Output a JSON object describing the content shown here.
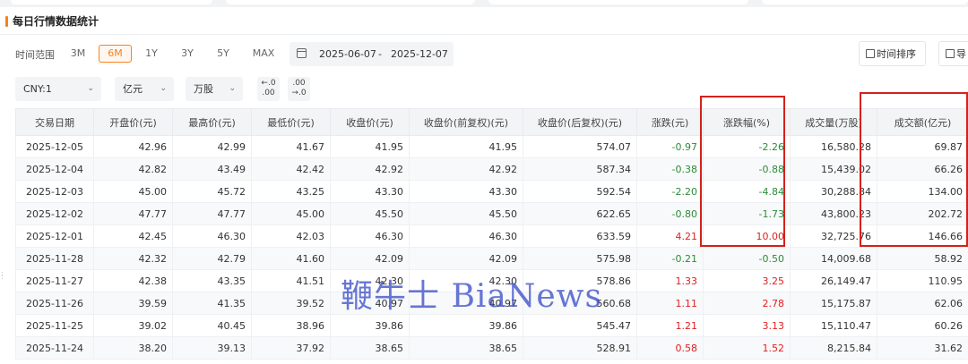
{
  "section": {
    "title": "每日行情数据统计"
  },
  "range": {
    "label": "时间范围",
    "options": [
      "3M",
      "6M",
      "1Y",
      "3Y",
      "5Y",
      "MAX"
    ],
    "active": "6M",
    "start": "2025-06-07",
    "separator": "-",
    "end": "2025-12-07"
  },
  "tools": {
    "sort_label": "时间排序",
    "export_label": "导"
  },
  "selects": {
    "currency": "CNY:1",
    "amount_unit": "亿元",
    "volume_unit": "万股"
  },
  "decimal": {
    "decrease": "←.0\n.00",
    "increase": ".00\n→.0"
  },
  "table": {
    "headers": [
      "交易日期",
      "开盘价(元)",
      "最高价(元)",
      "最低价(元)",
      "收盘价(元)",
      "收盘价(前复权)(元)",
      "收盘价(后复权)(元)",
      "涨跌(元)",
      "涨跌幅(%)",
      "成交量(万股)",
      "成交额(亿元)"
    ],
    "rows": [
      [
        "2025-12-05",
        "42.96",
        "42.99",
        "41.67",
        "41.95",
        "41.95",
        "574.07",
        "-0.97",
        "-2.26",
        "16,580.28",
        "69.87"
      ],
      [
        "2025-12-04",
        "42.82",
        "43.49",
        "42.42",
        "42.92",
        "42.92",
        "587.34",
        "-0.38",
        "-0.88",
        "15,439.02",
        "66.26"
      ],
      [
        "2025-12-03",
        "45.00",
        "45.72",
        "43.25",
        "43.30",
        "43.30",
        "592.54",
        "-2.20",
        "-4.84",
        "30,288.84",
        "134.00"
      ],
      [
        "2025-12-02",
        "47.77",
        "47.77",
        "45.00",
        "45.50",
        "45.50",
        "622.65",
        "-0.80",
        "-1.73",
        "43,800.23",
        "202.72"
      ],
      [
        "2025-12-01",
        "42.45",
        "46.30",
        "42.03",
        "46.30",
        "46.30",
        "633.59",
        "4.21",
        "10.00",
        "32,725.76",
        "146.66"
      ],
      [
        "2025-11-28",
        "42.32",
        "42.79",
        "41.60",
        "42.09",
        "42.09",
        "575.98",
        "-0.21",
        "-0.50",
        "14,009.68",
        "58.92"
      ],
      [
        "2025-11-27",
        "42.38",
        "43.35",
        "41.51",
        "42.30",
        "42.30",
        "578.86",
        "1.33",
        "3.25",
        "26,149.47",
        "110.95"
      ],
      [
        "2025-11-26",
        "39.59",
        "41.35",
        "39.52",
        "40.97",
        "40.97",
        "560.68",
        "1.11",
        "2.78",
        "15,175.87",
        "62.06"
      ],
      [
        "2025-11-25",
        "39.02",
        "40.45",
        "38.96",
        "39.86",
        "39.86",
        "545.47",
        "1.21",
        "3.13",
        "15,110.47",
        "60.26"
      ],
      [
        "2025-11-24",
        "38.20",
        "39.13",
        "37.92",
        "38.65",
        "38.65",
        "528.91",
        "0.58",
        "1.52",
        "8,215.84",
        "31.62"
      ]
    ]
  },
  "watermark": "鞭牛士 BiaNews",
  "colors": {
    "accent": "#f58220",
    "rise": "#e02020",
    "fall": "#2d8b3a",
    "highlight": "#d5211b"
  }
}
